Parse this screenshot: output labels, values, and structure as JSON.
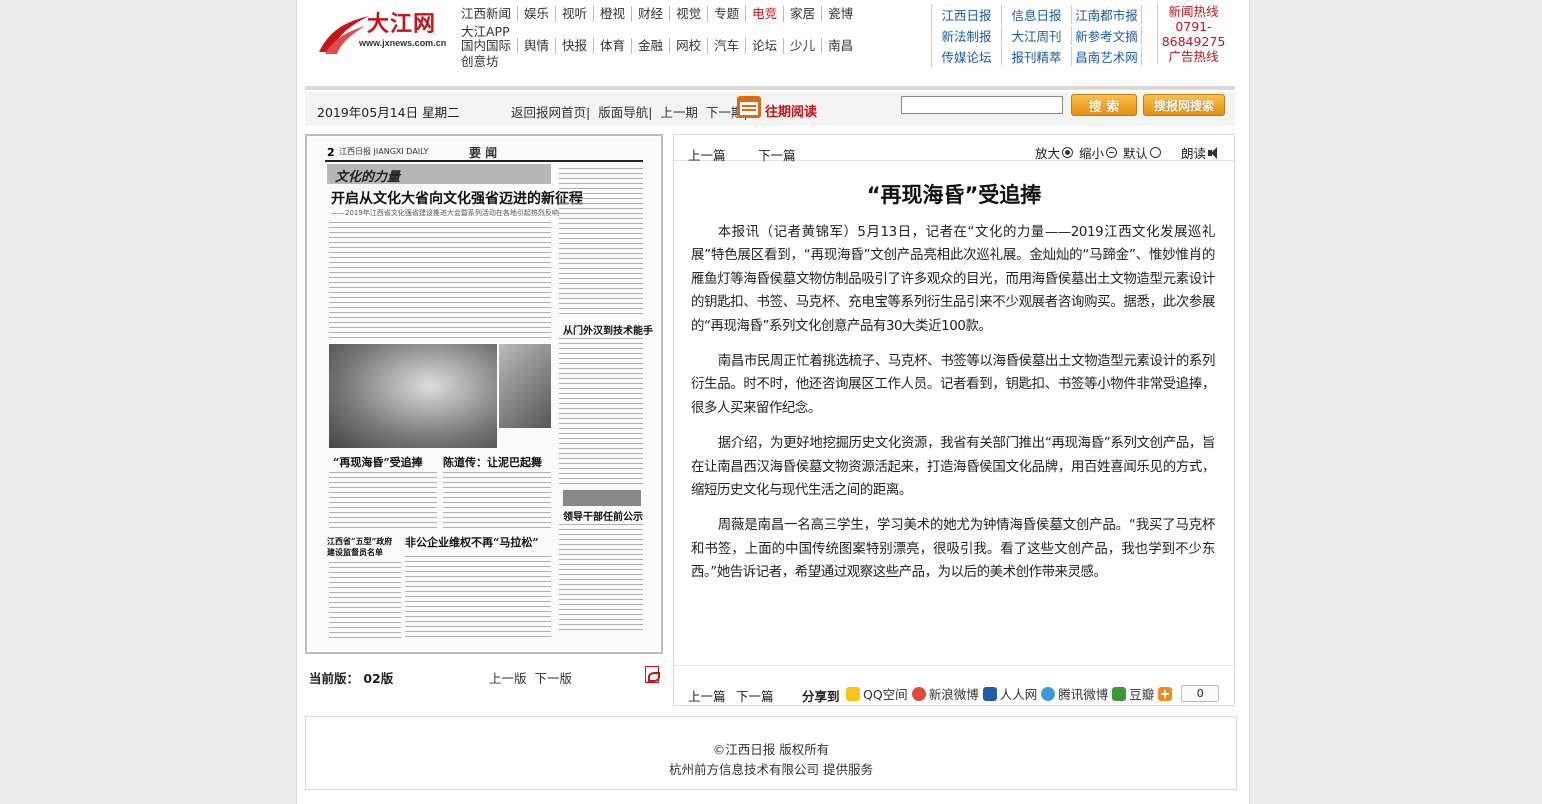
{
  "logo": {
    "name": "大江网",
    "url": "www.jxnews.com.cn"
  },
  "nav_main": {
    "row1": [
      "江西新闻",
      "娱乐",
      "视听",
      "橙视",
      "财经",
      "视觉",
      "专题",
      "电竞",
      "家居",
      "瓷博"
    ],
    "row1b": [
      "大江APP"
    ],
    "row2": [
      "国内国际",
      "舆情",
      "快报",
      "体育",
      "金融",
      "网校",
      "汽车",
      "论坛",
      "少儿",
      "南昌"
    ],
    "row2b": [
      "创意坊"
    ]
  },
  "nav_papers": [
    [
      "江西日报",
      "信息日报",
      "江南都市报"
    ],
    [
      "新法制报",
      "大江周刊",
      "新参考文摘"
    ],
    [
      "传媒论坛",
      "报刊精萃",
      "昌南艺术网"
    ]
  ],
  "hotline": {
    "label": "新闻热线",
    "number1": "0791-",
    "number2": "86849275",
    "ad": "广告热线"
  },
  "toolbar": {
    "date": "2019年05月14日 星期二",
    "home": "返回报网首页|",
    "layout_nav": "版面导航|",
    "prev": "上一期",
    "next": "下一期|",
    "past_read": "往期阅读",
    "search_value": "",
    "search_btn": "搜 索",
    "news_search_btn": "搜报网搜索"
  },
  "page_image": {
    "num": "2",
    "masthead": "江西日报 JIANGXI DAILY",
    "section": "要 闻",
    "banner": "文化的力量",
    "headline": "开启从文化大省向文化强省迈进的新征程",
    "subhead": "——2019年江西省文化强省建设推进大会暨系列活动在各地引起热烈反响",
    "item1": "“再现海昏”受追捧",
    "item2": "陈道传：让泥巴起舞",
    "item3": "从门外汉到技术能手",
    "item4": "领导干部任前公示",
    "item5": "非公企业维权不再“马拉松”",
    "item6": "江西省“五型”政府建设监督员名单"
  },
  "pagebar": {
    "current": "当前版： 02版",
    "prev": "上一版",
    "next": "下一版"
  },
  "article": {
    "prev": "上一篇",
    "next": "下一篇",
    "zoom_in": "放大",
    "zoom_out": "缩小",
    "default": "默认",
    "read": "朗读",
    "title": "“再现海昏”受追捧",
    "paragraphs": [
      "本报讯（记者黄锦军）5月13日，记者在“文化的力量——2019江西文化发展巡礼展”特色展区看到，“再现海昏”文创产品亮相此次巡礼展。金灿灿的“马蹄金”、惟妙惟肖的雁鱼灯等海昏侯墓文物仿制品吸引了许多观众的目光，而用海昏侯墓出土文物造型元素设计的钥匙扣、书签、马克杯、充电宝等系列衍生品引来不少观展者咨询购买。据悉，此次参展的“再现海昏”系列文化创意产品有30大类近100款。",
      "南昌市民周正忙着挑选梳子、马克杯、书签等以海昏侯墓出土文物造型元素设计的系列衍生品。时不时，他还咨询展区工作人员。记者看到，钥匙扣、书签等小物件非常受追捧，很多人买来留作纪念。",
      "据介绍，为更好地挖掘历史文化资源，我省有关部门推出“再现海昏”系列文创产品，旨在让南昌西汉海昏侯墓文物资源活起来，打造海昏侯国文化品牌，用百姓喜闻乐见的方式，缩短历史文化与现代生活之间的距离。",
      "周薇是南昌一名高三学生，学习美术的她尤为钟情海昏侯墓文创产品。“我买了马克杯和书签，上面的中国传统图案特别漂亮，很吸引我。看了这些文创产品，我也学到不少东西。”她告诉记者，希望通过观察这些产品，为以后的美术创作带来灵感。"
    ],
    "share_label": "分享到",
    "shares": [
      "QQ空间",
      "新浪微博",
      "人人网",
      "腾讯微博",
      "豆瓣"
    ],
    "count": "0"
  },
  "footer": {
    "copyright": "©江西日报 版权所有",
    "provider": "杭州前方信息技术有限公司 提供服务"
  },
  "colors": {
    "brand_red": "#c8121a",
    "link_blue": "#1a5aa6",
    "button_orange": "#e78d10"
  }
}
